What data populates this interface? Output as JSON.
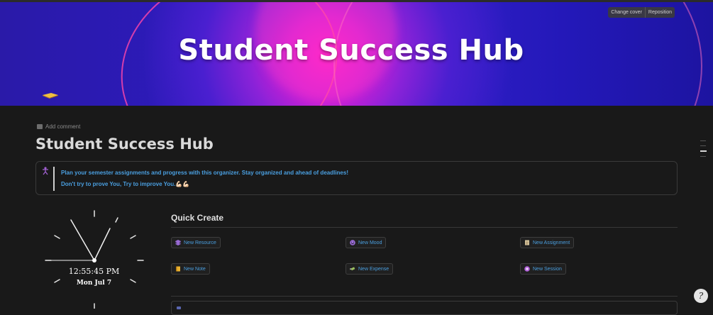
{
  "cover": {
    "title": "Student Success Hub",
    "change_cover_label": "Change cover",
    "reposition_label": "Reposition"
  },
  "page": {
    "add_comment_label": "Add comment",
    "title": "Student Success Hub"
  },
  "callout": {
    "icon": "person-pose-icon",
    "line1": "Plan your semester assignments and progress with this organizer. Stay organized and ahead of deadlines!",
    "line2": "Don't try to prove You, Try to improve You.💪🏻💪🏻"
  },
  "clock": {
    "time": "12:55:45 PM",
    "date": "Mon Jul 7"
  },
  "quick_create": {
    "heading": "Quick Create",
    "buttons": [
      {
        "label": "New Resource",
        "icon": "layers-icon",
        "color": "#9b6cd8"
      },
      {
        "label": "New Mood",
        "icon": "smiley-icon",
        "color": "#9b6cd8"
      },
      {
        "label": "New Assignment",
        "icon": "notepad-icon",
        "color": "#d8c8a0"
      },
      {
        "label": "New Note",
        "icon": "notebook-icon",
        "color": "#e8b030"
      },
      {
        "label": "New Expense",
        "icon": "money-wings-icon",
        "color": "#9bc060"
      },
      {
        "label": "New Session",
        "icon": "plus-circle-icon",
        "color": "#b060d8"
      }
    ]
  },
  "help": {
    "label": "?"
  },
  "colors": {
    "background": "#191919",
    "accent_text": "#4a9fe0",
    "cover_pink": "#ff1fc8",
    "cover_blue": "#2d1bc0"
  }
}
